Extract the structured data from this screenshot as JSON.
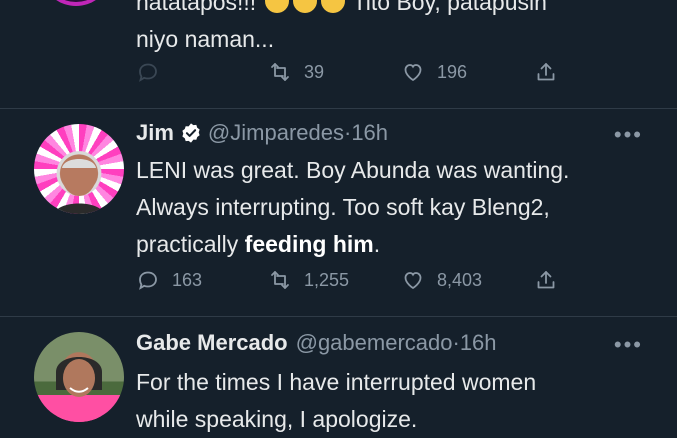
{
  "top_tweet": {
    "line1": "natatapos!!!",
    "line1_rest": "Tito Boy, patapusin",
    "line2": "niyo naman...",
    "actions": {
      "reply": "",
      "retweet": "39",
      "like": "196"
    }
  },
  "tweet1": {
    "name": "Jim",
    "handle": "@Jimparedes",
    "time": "16h",
    "text_line1": "LENI was great. Boy Abunda was wanting.",
    "text_line2": "Always interrupting. Too soft kay Bleng2,",
    "text_line3_a": "practically ",
    "text_line3_b": "feeding him",
    "text_line3_c": ".",
    "actions": {
      "reply": "163",
      "retweet": "1,255",
      "like": "8,403"
    }
  },
  "tweet2": {
    "name": "Gabe Mercado",
    "handle": "@gabemercado",
    "time": "16h",
    "text_line1": "For the times I have interrupted women",
    "text_line2": "while speaking, I apologize."
  },
  "more_glyph": "•••",
  "separator": " · ",
  "colors": {
    "background": "#15202b",
    "muted": "#8b98a5",
    "text": "#e7e9ea",
    "verified": "#1d9bf0"
  },
  "icons": [
    "reply-icon",
    "retweet-icon",
    "like-icon",
    "share-icon",
    "verified-icon",
    "more-icon"
  ]
}
